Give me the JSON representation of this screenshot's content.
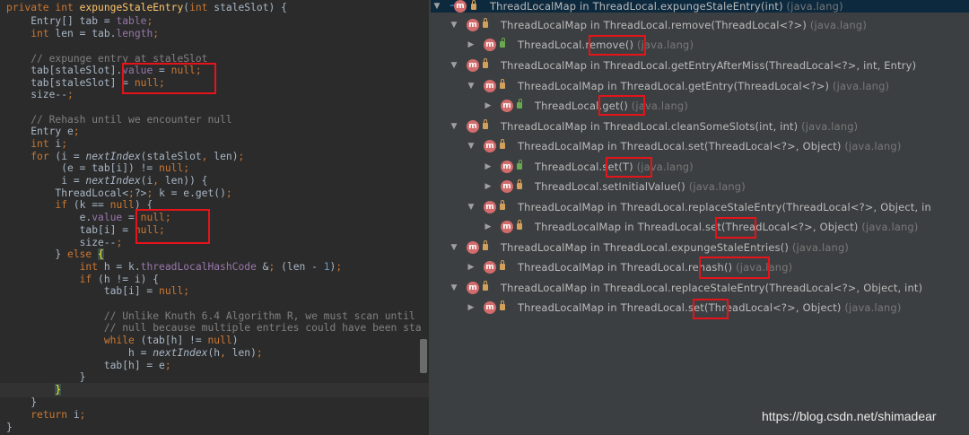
{
  "editor": {
    "lines": [
      "private int expungeStaleEntry(int staleSlot) {",
      "    Entry[] tab = table;",
      "    int len = tab.length;",
      "",
      "    // expunge entry at staleSlot",
      "    tab[staleSlot].value = null;",
      "    tab[staleSlot] = null;",
      "    size--;",
      "",
      "    // Rehash until we encounter null",
      "    Entry e;",
      "    int i;",
      "    for (i = nextIndex(staleSlot, len);",
      "         (e = tab[i]) != null;",
      "         i = nextIndex(i, len)) {",
      "        ThreadLocal<?> k = e.get();",
      "        if (k == null) {",
      "            e.value = null;",
      "            tab[i] = null;",
      "            size--;",
      "        } else {",
      "            int h = k.threadLocalHashCode & (len - 1);",
      "            if (h != i) {",
      "                tab[i] = null;",
      "",
      "                // Unlike Knuth 6.4 Algorithm R, we must scan until",
      "                // null because multiple entries could have been sta",
      "                while (tab[h] != null)",
      "                    h = nextIndex(h, len);",
      "                tab[h] = e;",
      "            }",
      "        }",
      "    }",
      "    return i;",
      "}"
    ]
  },
  "hierarchy": {
    "rows": [
      {
        "text": "ThreadLocalMap in ThreadLocal.expungeStaleEntry(int)",
        "pkg": "(java.lang)",
        "indent": 0,
        "arrow": "▼",
        "icon": "method-icon",
        "lock": "private",
        "selected": true
      },
      {
        "text": "ThreadLocalMap in ThreadLocal.remove(ThreadLocal<?>)",
        "pkg": "(java.lang)",
        "indent": 1,
        "arrow": "▼",
        "icon": "method-icon",
        "lock": "private"
      },
      {
        "text": "ThreadLocal.remove()",
        "pkg": "(java.lang)",
        "indent": 2,
        "arrow": "▶",
        "icon": "method-icon",
        "lock": "public"
      },
      {
        "text": "ThreadLocalMap in ThreadLocal.getEntryAfterMiss(ThreadLocal<?>, int, Entry)",
        "pkg": "",
        "indent": 1,
        "arrow": "▼",
        "icon": "method-icon",
        "lock": "private"
      },
      {
        "text": "ThreadLocalMap in ThreadLocal.getEntry(ThreadLocal<?>)",
        "pkg": "(java.lang)",
        "indent": 2,
        "arrow": "▼",
        "icon": "method-icon",
        "lock": "private"
      },
      {
        "text": "ThreadLocal.get()",
        "pkg": "(java.lang)",
        "indent": 3,
        "arrow": "▶",
        "icon": "method-icon",
        "lock": "public"
      },
      {
        "text": "ThreadLocalMap in ThreadLocal.cleanSomeSlots(int, int)",
        "pkg": "(java.lang)",
        "indent": 1,
        "arrow": "▼",
        "icon": "method-icon",
        "lock": "private"
      },
      {
        "text": "ThreadLocalMap in ThreadLocal.set(ThreadLocal<?>, Object)",
        "pkg": "(java.lang)",
        "indent": 2,
        "arrow": "▼",
        "icon": "method-icon",
        "lock": "private"
      },
      {
        "text": "ThreadLocal.set(T)",
        "pkg": "(java.lang)",
        "indent": 3,
        "arrow": "▶",
        "icon": "method-icon",
        "lock": "public"
      },
      {
        "text": "ThreadLocal.setInitialValue()",
        "pkg": "(java.lang)",
        "indent": 3,
        "arrow": "▶",
        "icon": "method-icon",
        "lock": "private"
      },
      {
        "text": "ThreadLocalMap in ThreadLocal.replaceStaleEntry(ThreadLocal<?>, Object, in",
        "pkg": "",
        "indent": 2,
        "arrow": "▼",
        "icon": "method-icon",
        "lock": "private"
      },
      {
        "text": "ThreadLocalMap in ThreadLocal.set(ThreadLocal<?>, Object)",
        "pkg": "(java.lang)",
        "indent": 3,
        "arrow": "▶",
        "icon": "method-icon",
        "lock": "private"
      },
      {
        "text": "ThreadLocalMap in ThreadLocal.expungeStaleEntries()",
        "pkg": "(java.lang)",
        "indent": 1,
        "arrow": "▼",
        "icon": "method-icon",
        "lock": "private"
      },
      {
        "text": "ThreadLocalMap in ThreadLocal.rehash()",
        "pkg": "(java.lang)",
        "indent": 2,
        "arrow": "▶",
        "icon": "method-icon",
        "lock": "private"
      },
      {
        "text": "ThreadLocalMap in ThreadLocal.replaceStaleEntry(ThreadLocal<?>, Object, int)",
        "pkg": "",
        "indent": 1,
        "arrow": "▼",
        "icon": "method-icon",
        "lock": "private"
      },
      {
        "text": "ThreadLocalMap in ThreadLocal.set(ThreadLocal<?>, Object)",
        "pkg": "(java.lang)",
        "indent": 2,
        "arrow": "▶",
        "icon": "method-icon",
        "lock": "private"
      }
    ]
  },
  "watermark": "https://blog.csdn.net/shimadear",
  "colors": {
    "highlight_box": "#e5141b",
    "method_icon": "#d26b6b",
    "selection": "#0d293e"
  }
}
